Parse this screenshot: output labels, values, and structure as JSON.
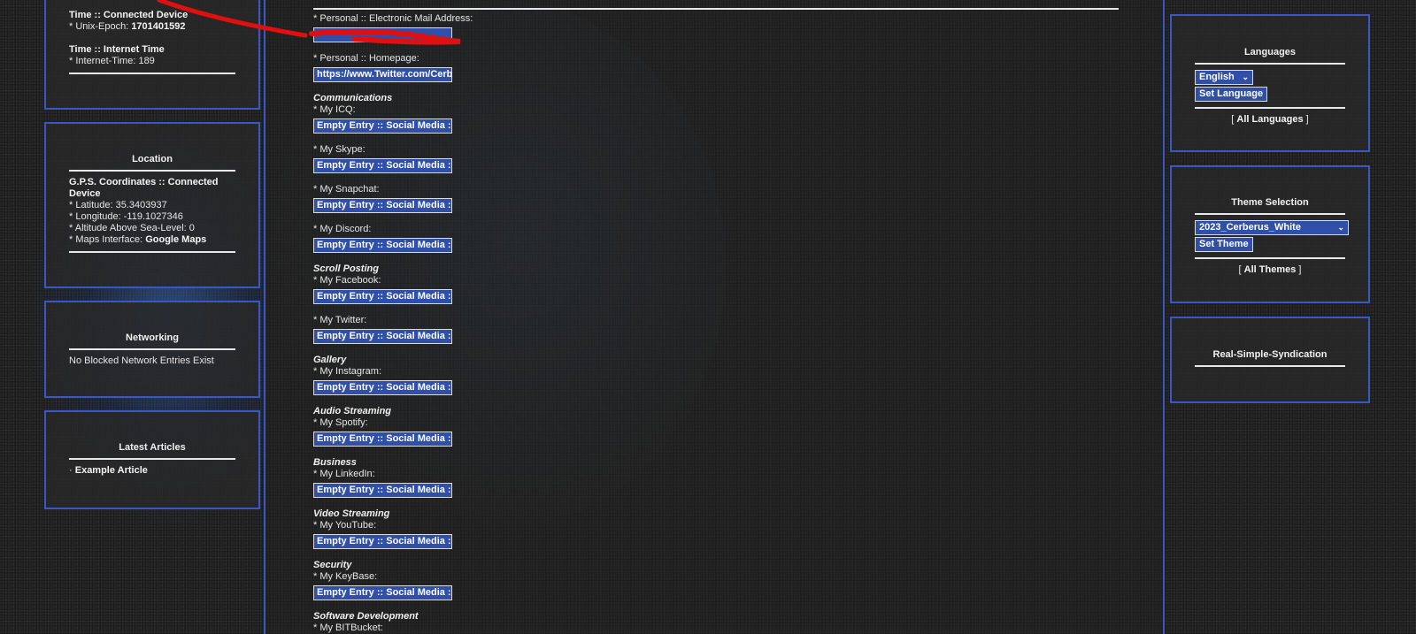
{
  "left": {
    "time": {
      "connected_title": "Time :: Connected Device",
      "unix_label": "* Unix-Epoch: ",
      "unix_value": "1701401592",
      "internet_title": "Time :: Internet Time",
      "internet_line": "* Internet-Time: 189"
    },
    "location": {
      "title": "Location",
      "gps_title": "G.P.S. Coordinates :: Connected Device",
      "latitude": "* Latitude: 35.3403937",
      "longitude": "* Longitude: -119.1027346",
      "altitude": "* Altitude Above Sea-Level: 0",
      "maps_label": "* Maps Interface: ",
      "maps_link": "Google Maps"
    },
    "networking": {
      "title": "Networking",
      "text": "No Blocked Network Entries Exist"
    },
    "articles": {
      "title": "Latest Articles",
      "bullet": "·",
      "item": "Example Article"
    }
  },
  "center": {
    "email_label": "* Personal :: Electronic Mail Address:",
    "email_value": "",
    "homepage_label": "* Personal :: Homepage:",
    "homepage_value": "https://www.Twitter.com/Cerb",
    "empty_value": "Empty Entry :: Social Media :",
    "groups": [
      {
        "title": "Communications",
        "fields": [
          "* My ICQ:",
          "* My Skype:",
          "* My Snapchat:",
          "* My Discord:"
        ]
      },
      {
        "title": "Scroll Posting",
        "fields": [
          "* My Facebook:",
          "* My Twitter:"
        ]
      },
      {
        "title": "Gallery",
        "fields": [
          "* My Instagram:"
        ]
      },
      {
        "title": "Audio Streaming",
        "fields": [
          "* My Spotify:"
        ]
      },
      {
        "title": "Business",
        "fields": [
          "* My LinkedIn:"
        ]
      },
      {
        "title": "Video Streaming",
        "fields": [
          "* My YouTube:"
        ]
      },
      {
        "title": "Security",
        "fields": [
          "* My KeyBase:"
        ]
      },
      {
        "title": "Software Development",
        "fields": [
          "* My BITBucket:"
        ]
      }
    ]
  },
  "right": {
    "languages": {
      "title": "Languages",
      "selected": "English",
      "button": "Set Language",
      "link_open": "[ ",
      "link": "All Languages",
      "link_close": " ]"
    },
    "themes": {
      "title": "Theme Selection",
      "selected": "2023_Cerberus_White",
      "button": "Set Theme",
      "link_open": "[ ",
      "link": "All Themes",
      "link_close": " ]"
    },
    "rss": {
      "title": "Real-Simple-Syndication"
    }
  },
  "colors": {
    "accent_border": "#3a57c4",
    "input_bg": "#2f4fa8",
    "annotation": "#e01010"
  }
}
